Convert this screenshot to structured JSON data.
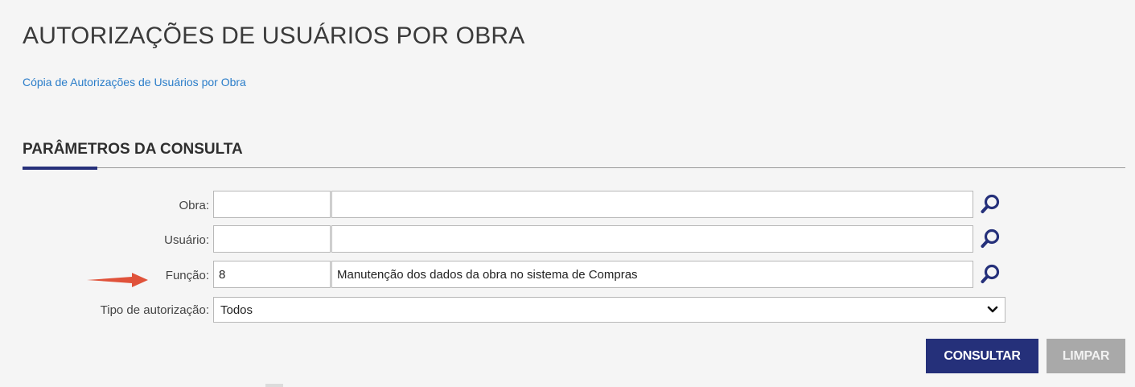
{
  "page": {
    "title": "AUTORIZAÇÕES DE USUÁRIOS POR OBRA",
    "copy_link": "Cópia de Autorizações de Usuários por Obra"
  },
  "section": {
    "title": "PARÂMETROS DA CONSULTA"
  },
  "form": {
    "obra": {
      "label": "Obra:",
      "code": "",
      "description": ""
    },
    "usuario": {
      "label": "Usuário:",
      "code": "",
      "description": ""
    },
    "funcao": {
      "label": "Função:",
      "code": "8",
      "description": "Manutenção dos dados da obra no sistema de Compras"
    },
    "tipo": {
      "label": "Tipo de autorização:",
      "selected": "Todos"
    }
  },
  "actions": {
    "consultar": "CONSULTAR",
    "limpar": "LIMPAR"
  },
  "icons": {
    "lookup": "search-icon",
    "dropdown": "chevron-down-icon",
    "pointer": "arrow-right-icon"
  },
  "colors": {
    "primary": "#25307a",
    "link": "#2a7dc9",
    "arrow": "#e0523a",
    "disabled": "#a9a9a9"
  }
}
